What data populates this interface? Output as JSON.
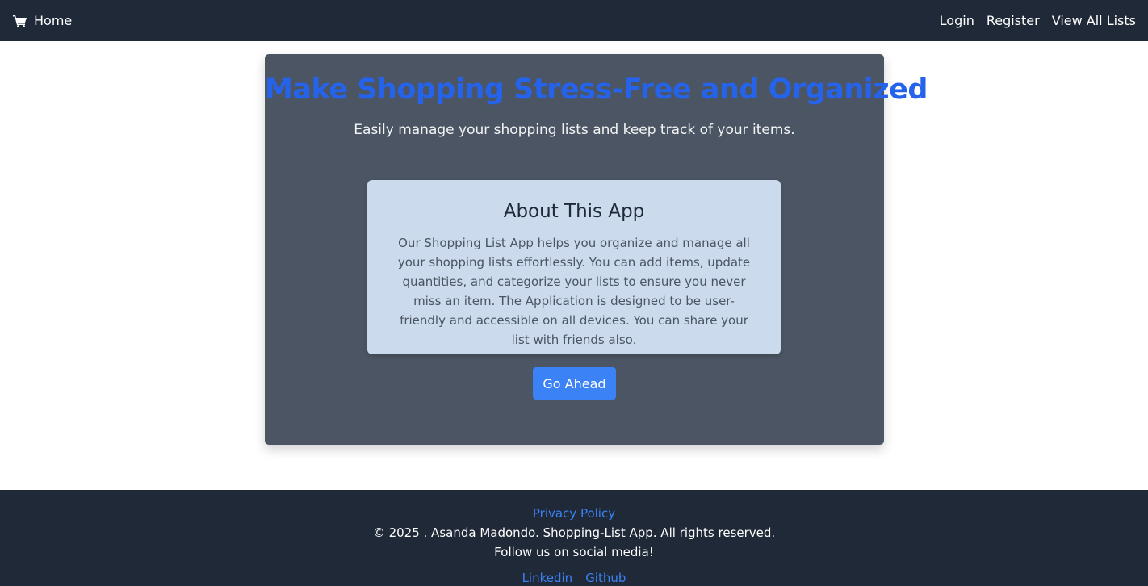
{
  "navbar": {
    "home_icon": "shopping-cart-icon",
    "home_label": "Home",
    "links": [
      {
        "label": "Login"
      },
      {
        "label": "Register"
      },
      {
        "label": "View All Lists"
      }
    ]
  },
  "hero": {
    "title": "Make Shopping Stress-Free and Organized",
    "subtitle": "Easily manage your shopping lists and keep track of your items.",
    "about": {
      "title": "About This App",
      "text": "Our Shopping List App helps you organize and manage all your shopping lists effortlessly. You can add items, update quantities, and categorize your lists to ensure you never miss an item. The Application is designed to be user-friendly and accessible on all devices. You can share your list with friends also."
    },
    "button_label": "Go Ahead"
  },
  "footer": {
    "privacy_label": "Privacy Policy",
    "copyright": "© 2025 . Asanda Madondo. Shopping-List App. All rights reserved.",
    "follow_text": "Follow us on social media!",
    "social_links": [
      {
        "label": "Linkedin"
      },
      {
        "label": "Github"
      }
    ]
  },
  "colors": {
    "navbar_bg": "#1f2937",
    "hero_bg": "#4b5563",
    "title_blue": "#2563eb",
    "card_bg": "#cbdaed",
    "button_bg": "#3b82f6",
    "link_blue": "#3b82f6"
  }
}
